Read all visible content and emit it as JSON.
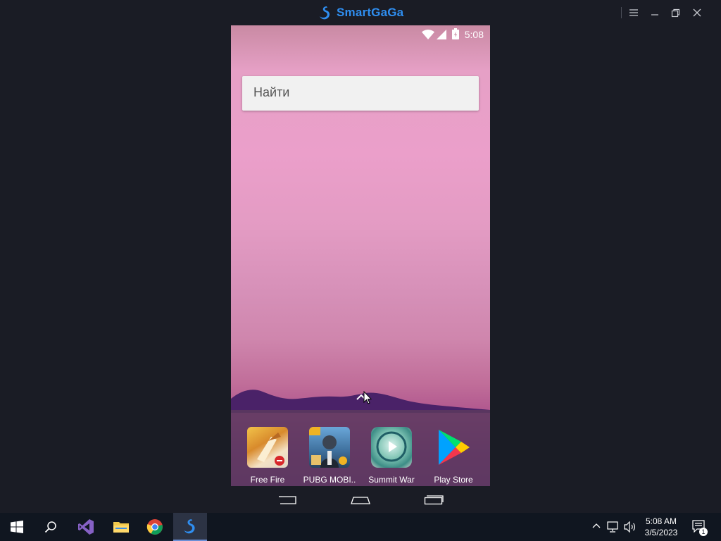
{
  "window": {
    "title": "SmartGaGa",
    "controls": [
      "menu-icon",
      "minimize-icon",
      "restore-icon",
      "close-icon"
    ]
  },
  "phone": {
    "status_time": "5:08",
    "search_placeholder": "Найти",
    "dock_apps": [
      {
        "label": "Free Fire",
        "icon": "free-fire-icon"
      },
      {
        "label": "PUBG MOBI..",
        "icon": "pubg-icon"
      },
      {
        "label": "Summit War",
        "icon": "summit-war-icon"
      },
      {
        "label": "Play Store",
        "icon": "play-store-icon"
      }
    ],
    "nav": [
      "back-icon",
      "home-icon",
      "recents-icon"
    ]
  },
  "taskbar": {
    "time": "5:08 AM",
    "date": "3/5/2023",
    "notification_count": "1"
  },
  "colors": {
    "brand": "#2f8ef0",
    "taskbar": "#101620",
    "titlebar": "#1a1c25"
  }
}
